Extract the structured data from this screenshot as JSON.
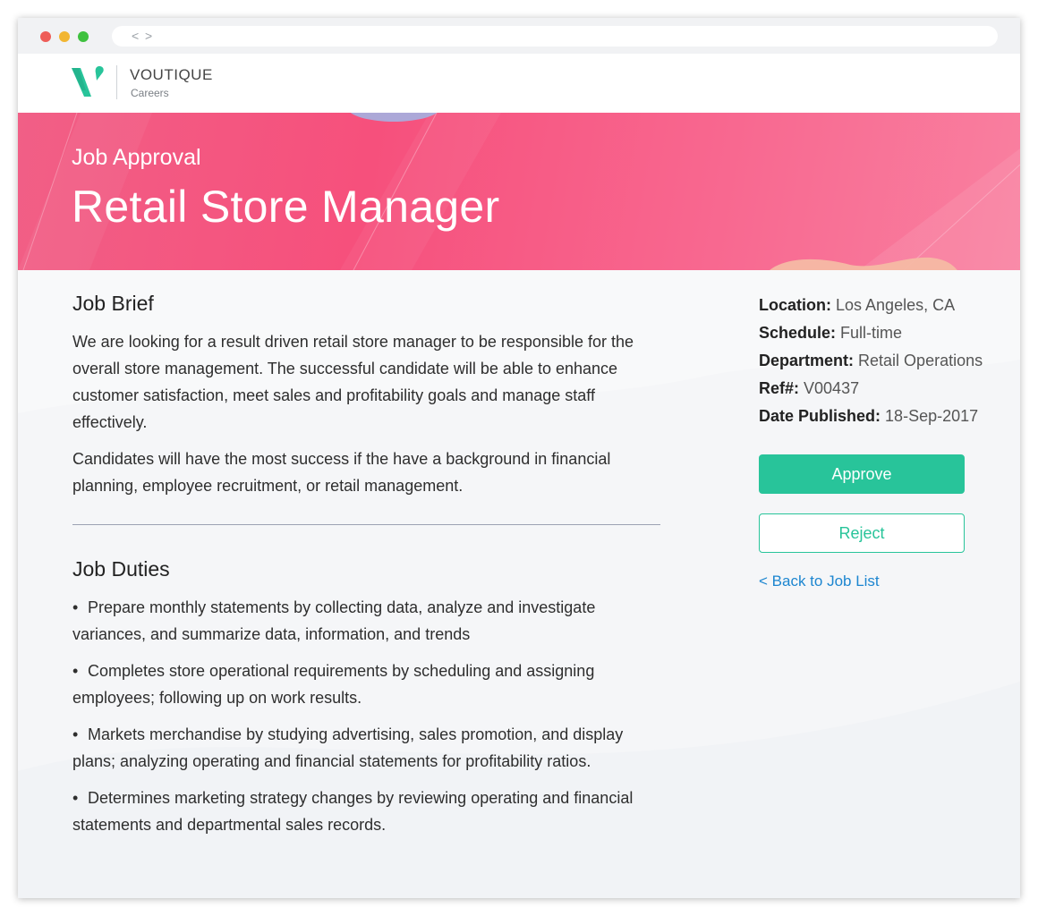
{
  "browser": {
    "back_glyph": "<",
    "forward_glyph": ">"
  },
  "header": {
    "brand_name": "VOUTIQUE",
    "brand_sub": "Careers",
    "logo_color": "#28c49a"
  },
  "banner": {
    "kicker": "Job Approval",
    "title": "Retail Store Manager",
    "accent": "#f6507c"
  },
  "job_brief": {
    "title": "Job Brief",
    "paragraphs": [
      "We are looking for a result driven retail store manager to be responsible for the overall store management. The successful candidate will be able to enhance customer satisfaction, meet sales and profitability goals and manage staff effectively.",
      "Candidates will have the most success if the have a background in financial planning, employee recruitment, or retail management."
    ]
  },
  "job_duties": {
    "title": "Job Duties",
    "bullet": "•",
    "items": [
      "Prepare monthly statements by collecting data, analyze and investigate variances, and summarize data, information, and trends",
      "Completes store operational requirements by scheduling and assigning employees; following up on work results.",
      "Markets merchandise by studying advertising, sales promotion, and display plans; analyzing operating and financial statements for profitability ratios.",
      "Determines marketing strategy changes by reviewing operating and financial statements and departmental sales records."
    ]
  },
  "details": {
    "location_key": "Location:",
    "location": "Los Angeles, CA",
    "schedule_key": "Schedule:",
    "schedule": "Full-time",
    "department_key": "Department:",
    "department": "Retail Operations",
    "ref_key": "Ref#:",
    "ref": "V00437",
    "date_key": "Date Published:",
    "date": "18-Sep-2017"
  },
  "actions": {
    "approve_label": "Approve",
    "reject_label": "Reject",
    "back_label": "< Back to Job List",
    "primary_color": "#28c49a",
    "link_color": "#1d86d0"
  }
}
